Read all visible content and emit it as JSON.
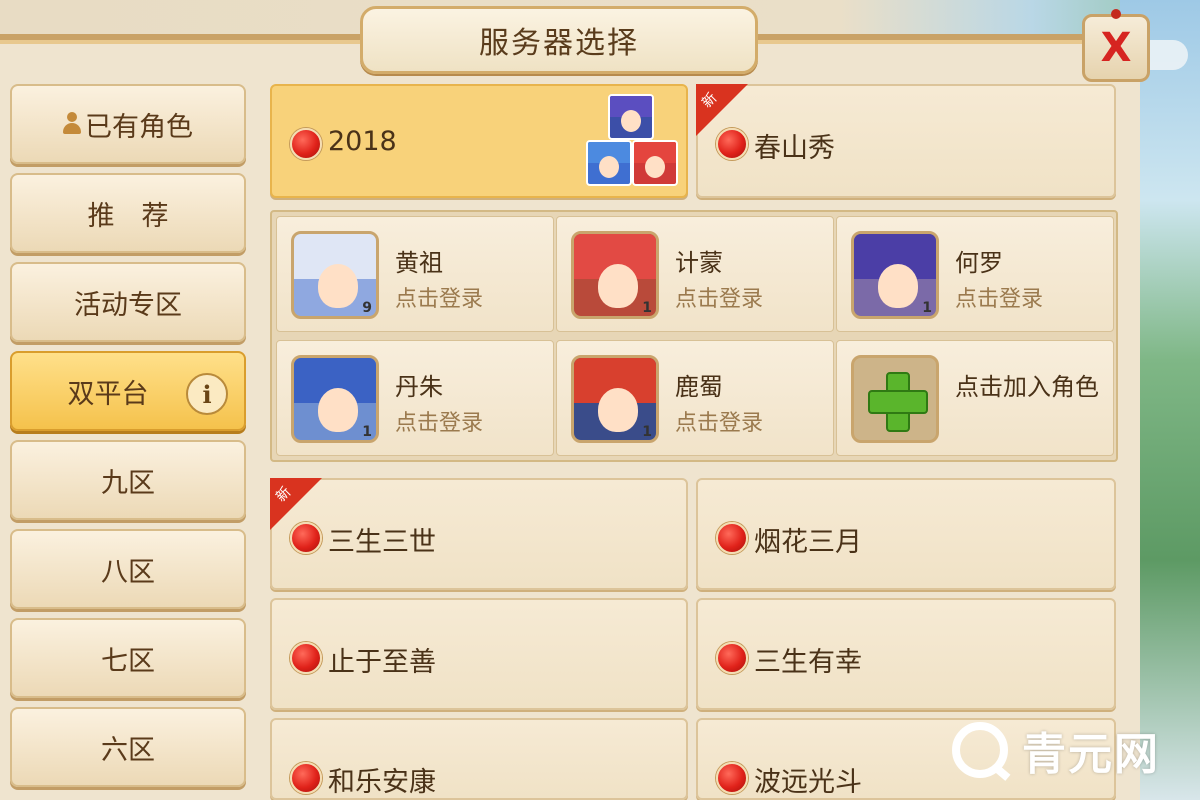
{
  "title": "服务器选择",
  "close_label": "X",
  "sidebar": {
    "items": [
      {
        "label": "已有角色"
      },
      {
        "label": "推　荐"
      },
      {
        "label": "活动专区"
      },
      {
        "label": "双平台"
      },
      {
        "label": "九区"
      },
      {
        "label": "八区"
      },
      {
        "label": "七区"
      },
      {
        "label": "六区"
      }
    ],
    "info_icon": "i"
  },
  "top_servers": [
    {
      "name": "2018",
      "selected": true
    },
    {
      "name": "春山秀",
      "new_badge": "新"
    }
  ],
  "roles": [
    {
      "name": "黄祖",
      "action": "点击登录",
      "level": "9"
    },
    {
      "name": "计蒙",
      "action": "点击登录",
      "level": "1"
    },
    {
      "name": "何罗",
      "action": "点击登录",
      "level": "1"
    },
    {
      "name": "丹朱",
      "action": "点击登录",
      "level": "1"
    },
    {
      "name": "鹿蜀",
      "action": "点击登录",
      "level": "1"
    },
    {
      "name": "点击加入角色"
    }
  ],
  "servers": [
    {
      "name": "三生三世",
      "new_badge": "新"
    },
    {
      "name": "烟花三月"
    },
    {
      "name": "止于至善"
    },
    {
      "name": "三生有幸"
    },
    {
      "name": "和乐安康"
    },
    {
      "name": "波远光斗"
    }
  ],
  "watermark": "青元网",
  "colors": {
    "accent_gold": "#f5c24c",
    "panel_bg": "#efe4cf",
    "status_red": "#e0221a",
    "close_red": "#d62420",
    "new_badge_red": "#d9331f"
  }
}
